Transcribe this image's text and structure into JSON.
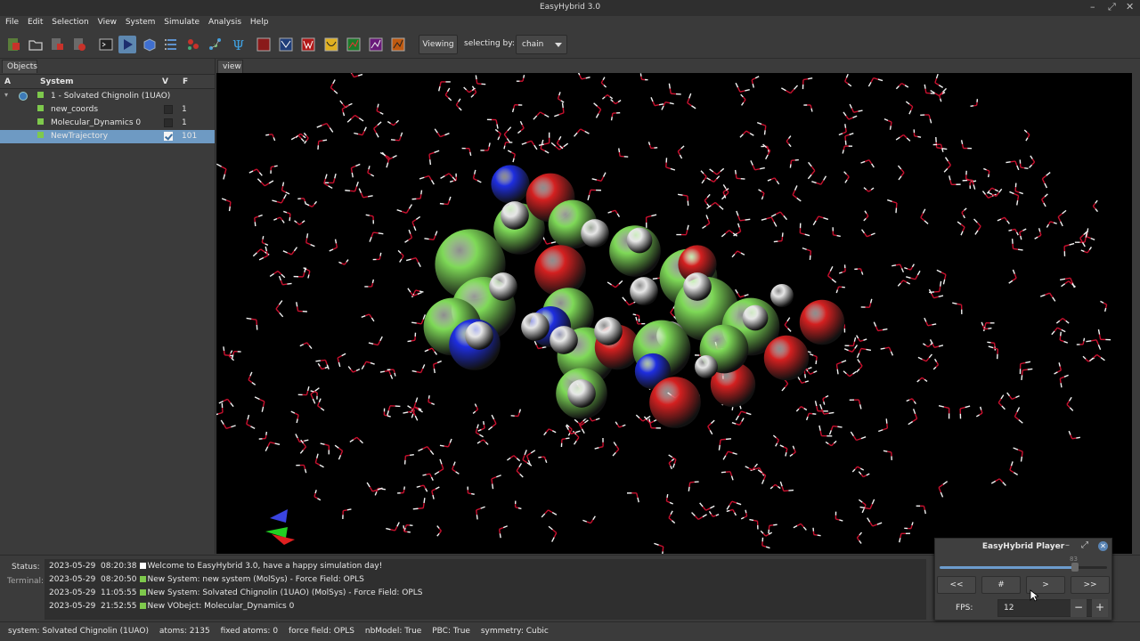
{
  "app": {
    "title": "EasyHybrid 3.0"
  },
  "menu": [
    "File",
    "Edit",
    "Selection",
    "View",
    "System",
    "Simulate",
    "Analysis",
    "Help"
  ],
  "toolbar": {
    "viewing_label": "Viewing",
    "selecting_by_label": "selecting by:",
    "selecting_by_value": "chain"
  },
  "objects_panel": {
    "tab_label": "Objects",
    "columns": {
      "a": "A",
      "system": "System",
      "v": "V",
      "f": "F"
    },
    "rows": [
      {
        "label": "1 - Solvated Chignolin (1UAO)",
        "frames": ""
      },
      {
        "label": "new_coords",
        "frames": "1"
      },
      {
        "label": "Molecular_Dynamics 0",
        "frames": "1"
      },
      {
        "label": "NewTrajectory",
        "frames": "101"
      }
    ]
  },
  "view_tab": {
    "label": "view"
  },
  "bottom": {
    "status_label": "Status:",
    "terminal_label": "Terminal:",
    "log": [
      {
        "date": "2023-05-29",
        "time": "08:20:38",
        "message": "Welcome to EasyHybrid 3.0, have a happy simulation day!",
        "color": "#ffffff"
      },
      {
        "date": "2023-05-29",
        "time": "08:20:50",
        "message": "New System:  new system (MolSys) - Force Field:  OPLS",
        "color": "#7ec94c"
      },
      {
        "date": "2023-05-29",
        "time": "11:05:55",
        "message": "New System:  Solvated Chignolin (1UAO) (MolSys) - Force Field:  OPLS",
        "color": "#7ec94c"
      },
      {
        "date": "2023-05-29",
        "time": "21:52:55",
        "message": "New VObejct:  Molecular_Dynamics 0",
        "color": "#7ec94c"
      }
    ]
  },
  "statusbar": {
    "system": "system: Solvated Chignolin (1UAO)",
    "atoms": "atoms: 2135",
    "fixed_atoms": "fixed atoms: 0",
    "force_field": "force field: OPLS",
    "nbmodel": "nbModel: True",
    "pbc": "PBC: True",
    "symmetry": "symmetry: Cubic"
  },
  "player": {
    "title": "EasyHybrid Player",
    "buttons": {
      "first": "<<",
      "number": "#",
      "play": ">",
      "last": ">>"
    },
    "fps_label": "FPS:",
    "fps_value": "12",
    "minus": "−",
    "plus": "+",
    "frame_position": 0.81,
    "slider_handle_label": "83"
  },
  "colors": {
    "selected_row": "#6e9ac3",
    "tree_bullet": "#7ec94c",
    "oxygen": "#d42020",
    "carbon": "#7ed957",
    "nitrogen": "#1e2ee0",
    "hydrogen": "#e6e6e6"
  }
}
